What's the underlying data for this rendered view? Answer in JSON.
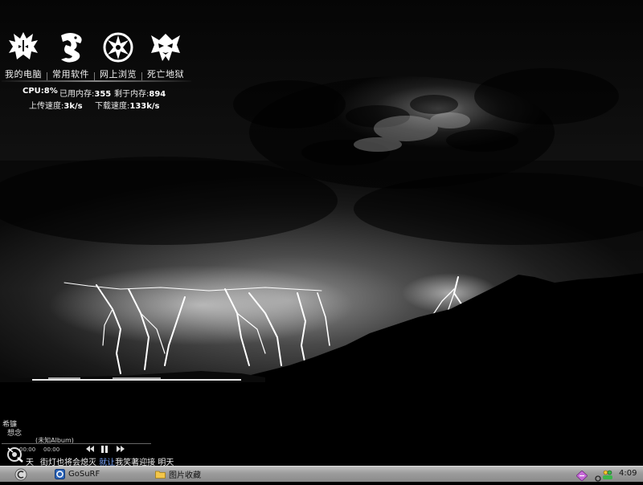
{
  "desktop": {
    "icons": [
      {
        "label": "我的电脑",
        "icon": "tribal-mask-icon"
      },
      {
        "label": "常用软件",
        "icon": "dragon-icon"
      },
      {
        "label": "网上浏览",
        "icon": "tribal-circle-icon"
      },
      {
        "label": "死亡地狱",
        "icon": "demon-face-icon"
      }
    ]
  },
  "sysmon": {
    "cpu_label": "CPU:",
    "cpu_value": "8%",
    "used_mem_label": "已用内存:",
    "used_mem_value": "355",
    "free_mem_label": "剩于内存:",
    "free_mem_value": "894",
    "upload_label": "上传速度:",
    "upload_value": "3k/s",
    "download_label": "下载速度:",
    "download_value": "133k/s"
  },
  "player": {
    "side_lyric_1": "希镰",
    "side_lyric_2": "想念",
    "album": "(未知Album)",
    "time_current": "00:00",
    "time_total": "00:00",
    "lyric_left": "天",
    "lyric_main": "街灯也将会熄灭 ",
    "lyric_highlight": "就让",
    "lyric_rest": "我笑著迎接 明天"
  },
  "taskbar": {
    "items": [
      {
        "label": "GoSuRF",
        "icon": "gosurf-icon"
      },
      {
        "label": "图片收藏",
        "icon": "folder-icon"
      }
    ],
    "clock": "4:09"
  },
  "colors": {
    "taskbar_top": "#bfbfbf",
    "taskbar_bottom": "#8a8a8a",
    "lyric_highlight": "#7aa7ff"
  }
}
